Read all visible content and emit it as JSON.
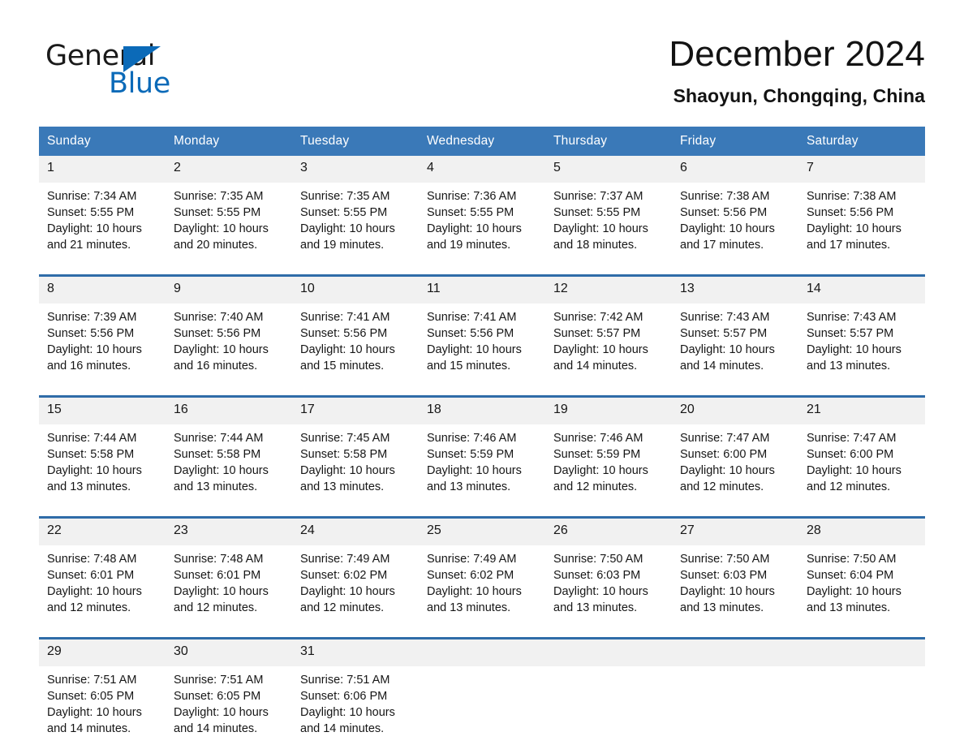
{
  "brand": {
    "name_part1": "General",
    "name_part2": "Blue",
    "triangle_icon": "triangle-icon",
    "accent_color": "#0b6ab8"
  },
  "header": {
    "title": "December 2024",
    "location": "Shaoyun, Chongqing, China"
  },
  "theme": {
    "header_blue": "#3a79b8",
    "separator_blue": "#2f6ca8",
    "daynum_band": "#f1f1f1"
  },
  "calendar": {
    "weekday_headers": [
      "Sunday",
      "Monday",
      "Tuesday",
      "Wednesday",
      "Thursday",
      "Friday",
      "Saturday"
    ],
    "weeks": [
      {
        "days": [
          {
            "num": "1",
            "sunrise": "Sunrise: 7:34 AM",
            "sunset": "Sunset: 5:55 PM",
            "daylight": "Daylight: 10 hours and 21 minutes."
          },
          {
            "num": "2",
            "sunrise": "Sunrise: 7:35 AM",
            "sunset": "Sunset: 5:55 PM",
            "daylight": "Daylight: 10 hours and 20 minutes."
          },
          {
            "num": "3",
            "sunrise": "Sunrise: 7:35 AM",
            "sunset": "Sunset: 5:55 PM",
            "daylight": "Daylight: 10 hours and 19 minutes."
          },
          {
            "num": "4",
            "sunrise": "Sunrise: 7:36 AM",
            "sunset": "Sunset: 5:55 PM",
            "daylight": "Daylight: 10 hours and 19 minutes."
          },
          {
            "num": "5",
            "sunrise": "Sunrise: 7:37 AM",
            "sunset": "Sunset: 5:55 PM",
            "daylight": "Daylight: 10 hours and 18 minutes."
          },
          {
            "num": "6",
            "sunrise": "Sunrise: 7:38 AM",
            "sunset": "Sunset: 5:56 PM",
            "daylight": "Daylight: 10 hours and 17 minutes."
          },
          {
            "num": "7",
            "sunrise": "Sunrise: 7:38 AM",
            "sunset": "Sunset: 5:56 PM",
            "daylight": "Daylight: 10 hours and 17 minutes."
          }
        ]
      },
      {
        "days": [
          {
            "num": "8",
            "sunrise": "Sunrise: 7:39 AM",
            "sunset": "Sunset: 5:56 PM",
            "daylight": "Daylight: 10 hours and 16 minutes."
          },
          {
            "num": "9",
            "sunrise": "Sunrise: 7:40 AM",
            "sunset": "Sunset: 5:56 PM",
            "daylight": "Daylight: 10 hours and 16 minutes."
          },
          {
            "num": "10",
            "sunrise": "Sunrise: 7:41 AM",
            "sunset": "Sunset: 5:56 PM",
            "daylight": "Daylight: 10 hours and 15 minutes."
          },
          {
            "num": "11",
            "sunrise": "Sunrise: 7:41 AM",
            "sunset": "Sunset: 5:56 PM",
            "daylight": "Daylight: 10 hours and 15 minutes."
          },
          {
            "num": "12",
            "sunrise": "Sunrise: 7:42 AM",
            "sunset": "Sunset: 5:57 PM",
            "daylight": "Daylight: 10 hours and 14 minutes."
          },
          {
            "num": "13",
            "sunrise": "Sunrise: 7:43 AM",
            "sunset": "Sunset: 5:57 PM",
            "daylight": "Daylight: 10 hours and 14 minutes."
          },
          {
            "num": "14",
            "sunrise": "Sunrise: 7:43 AM",
            "sunset": "Sunset: 5:57 PM",
            "daylight": "Daylight: 10 hours and 13 minutes."
          }
        ]
      },
      {
        "days": [
          {
            "num": "15",
            "sunrise": "Sunrise: 7:44 AM",
            "sunset": "Sunset: 5:58 PM",
            "daylight": "Daylight: 10 hours and 13 minutes."
          },
          {
            "num": "16",
            "sunrise": "Sunrise: 7:44 AM",
            "sunset": "Sunset: 5:58 PM",
            "daylight": "Daylight: 10 hours and 13 minutes."
          },
          {
            "num": "17",
            "sunrise": "Sunrise: 7:45 AM",
            "sunset": "Sunset: 5:58 PM",
            "daylight": "Daylight: 10 hours and 13 minutes."
          },
          {
            "num": "18",
            "sunrise": "Sunrise: 7:46 AM",
            "sunset": "Sunset: 5:59 PM",
            "daylight": "Daylight: 10 hours and 13 minutes."
          },
          {
            "num": "19",
            "sunrise": "Sunrise: 7:46 AM",
            "sunset": "Sunset: 5:59 PM",
            "daylight": "Daylight: 10 hours and 12 minutes."
          },
          {
            "num": "20",
            "sunrise": "Sunrise: 7:47 AM",
            "sunset": "Sunset: 6:00 PM",
            "daylight": "Daylight: 10 hours and 12 minutes."
          },
          {
            "num": "21",
            "sunrise": "Sunrise: 7:47 AM",
            "sunset": "Sunset: 6:00 PM",
            "daylight": "Daylight: 10 hours and 12 minutes."
          }
        ]
      },
      {
        "days": [
          {
            "num": "22",
            "sunrise": "Sunrise: 7:48 AM",
            "sunset": "Sunset: 6:01 PM",
            "daylight": "Daylight: 10 hours and 12 minutes."
          },
          {
            "num": "23",
            "sunrise": "Sunrise: 7:48 AM",
            "sunset": "Sunset: 6:01 PM",
            "daylight": "Daylight: 10 hours and 12 minutes."
          },
          {
            "num": "24",
            "sunrise": "Sunrise: 7:49 AM",
            "sunset": "Sunset: 6:02 PM",
            "daylight": "Daylight: 10 hours and 12 minutes."
          },
          {
            "num": "25",
            "sunrise": "Sunrise: 7:49 AM",
            "sunset": "Sunset: 6:02 PM",
            "daylight": "Daylight: 10 hours and 13 minutes."
          },
          {
            "num": "26",
            "sunrise": "Sunrise: 7:50 AM",
            "sunset": "Sunset: 6:03 PM",
            "daylight": "Daylight: 10 hours and 13 minutes."
          },
          {
            "num": "27",
            "sunrise": "Sunrise: 7:50 AM",
            "sunset": "Sunset: 6:03 PM",
            "daylight": "Daylight: 10 hours and 13 minutes."
          },
          {
            "num": "28",
            "sunrise": "Sunrise: 7:50 AM",
            "sunset": "Sunset: 6:04 PM",
            "daylight": "Daylight: 10 hours and 13 minutes."
          }
        ]
      },
      {
        "days": [
          {
            "num": "29",
            "sunrise": "Sunrise: 7:51 AM",
            "sunset": "Sunset: 6:05 PM",
            "daylight": "Daylight: 10 hours and 14 minutes."
          },
          {
            "num": "30",
            "sunrise": "Sunrise: 7:51 AM",
            "sunset": "Sunset: 6:05 PM",
            "daylight": "Daylight: 10 hours and 14 minutes."
          },
          {
            "num": "31",
            "sunrise": "Sunrise: 7:51 AM",
            "sunset": "Sunset: 6:06 PM",
            "daylight": "Daylight: 10 hours and 14 minutes."
          },
          {
            "num": "",
            "sunrise": "",
            "sunset": "",
            "daylight": ""
          },
          {
            "num": "",
            "sunrise": "",
            "sunset": "",
            "daylight": ""
          },
          {
            "num": "",
            "sunrise": "",
            "sunset": "",
            "daylight": ""
          },
          {
            "num": "",
            "sunrise": "",
            "sunset": "",
            "daylight": ""
          }
        ]
      }
    ]
  }
}
